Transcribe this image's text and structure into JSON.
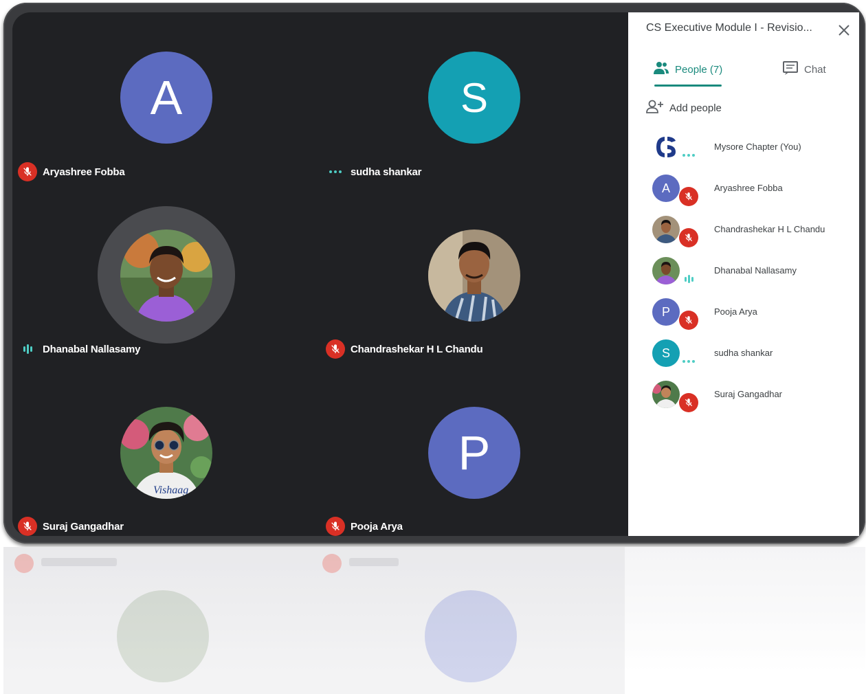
{
  "meeting": {
    "title": "CS Executive Module I - Revisio..."
  },
  "colors": {
    "accent": "#1a8a7d",
    "mic_off": "#d93025",
    "avatar_indigo": "#5c6bc0",
    "avatar_teal": "#14a0b3",
    "tile_bg": "#202124"
  },
  "tiles": [
    {
      "name": "Aryashree Fobba",
      "avatar": "A",
      "status": "muted"
    },
    {
      "name": "sudha shankar",
      "avatar": "S",
      "status": "connecting"
    },
    {
      "name": "Dhanabal Nallasamy",
      "avatar": "photo",
      "status": "speaking"
    },
    {
      "name": "Chandrashekar H L Chandu",
      "avatar": "photo",
      "status": "muted"
    },
    {
      "name": "Suraj Gangadhar",
      "avatar": "photo",
      "status": "muted"
    },
    {
      "name": "Pooja Arya",
      "avatar": "P",
      "status": "muted"
    }
  ],
  "panel": {
    "tabs": {
      "people_label": "People (7)",
      "chat_label": "Chat"
    },
    "add_people_label": "Add people",
    "people": [
      {
        "name": "Mysore Chapter (You)",
        "avatar": "logo",
        "status": "connecting"
      },
      {
        "name": "Aryashree Fobba",
        "avatar": "A",
        "status": "muted"
      },
      {
        "name": "Chandrashekar H L Chandu",
        "avatar": "photo",
        "status": "muted"
      },
      {
        "name": "Dhanabal Nallasamy",
        "avatar": "photo",
        "status": "speaking"
      },
      {
        "name": "Pooja Arya",
        "avatar": "P",
        "status": "muted"
      },
      {
        "name": "sudha shankar",
        "avatar": "S",
        "status": "connecting"
      },
      {
        "name": "Suraj Gangadhar",
        "avatar": "photo",
        "status": "muted"
      }
    ]
  },
  "icons": {
    "mic_off": "mic-off-icon",
    "speaking": "audio-bars-icon",
    "connecting": "dots-icon",
    "people": "people-icon",
    "chat": "chat-icon",
    "add_person": "add-person-icon",
    "close": "close-icon"
  }
}
